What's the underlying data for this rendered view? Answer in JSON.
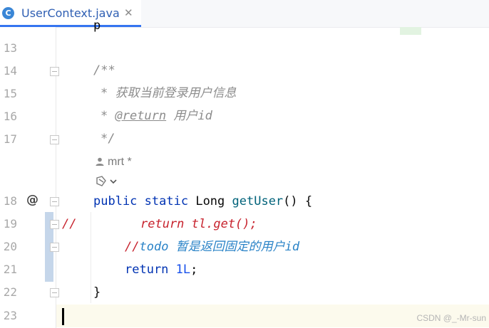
{
  "tab": {
    "icon_letter": "C",
    "title": "UserContext.java",
    "close": "✕"
  },
  "gutter": {
    "line_numbers": [
      "13",
      "14",
      "15",
      "16",
      "17",
      "18",
      "19",
      "20",
      "21",
      "22",
      "23"
    ],
    "annotation_marker": "@"
  },
  "code": {
    "top_partial": "p",
    "line14": "/**",
    "line15_star": "* ",
    "line15_text": "获取当前登录用户信息",
    "line16_star": "* ",
    "line16_tag": "@return",
    "line16_text": " 用户id",
    "line17": "*/",
    "hint_author": "mrt *",
    "line18_kw1": "public",
    "line18_kw2": "static",
    "line18_type": " Long ",
    "line18_fn": "getUser",
    "line18_rest": "() {",
    "line19_comment": "//",
    "line19_code": "return tl.get();",
    "line20_slashes": "//",
    "line20_todo": "todo",
    "line20_text": " 暂是返回固定的用户id",
    "line21_kw": "return",
    "line21_num": "1L",
    "line21_end": ";",
    "line22": "}"
  },
  "watermark": "CSDN @_-Mr-sun",
  "colors": {
    "keyword": "#0033b3",
    "method": "#00627a",
    "number": "#1750eb",
    "comment": "#8c8c8c",
    "commented_code": "#c7222d",
    "todo": "#2a83c7",
    "tab_accent": "#3574f0",
    "current_line": "#fcfaed"
  }
}
